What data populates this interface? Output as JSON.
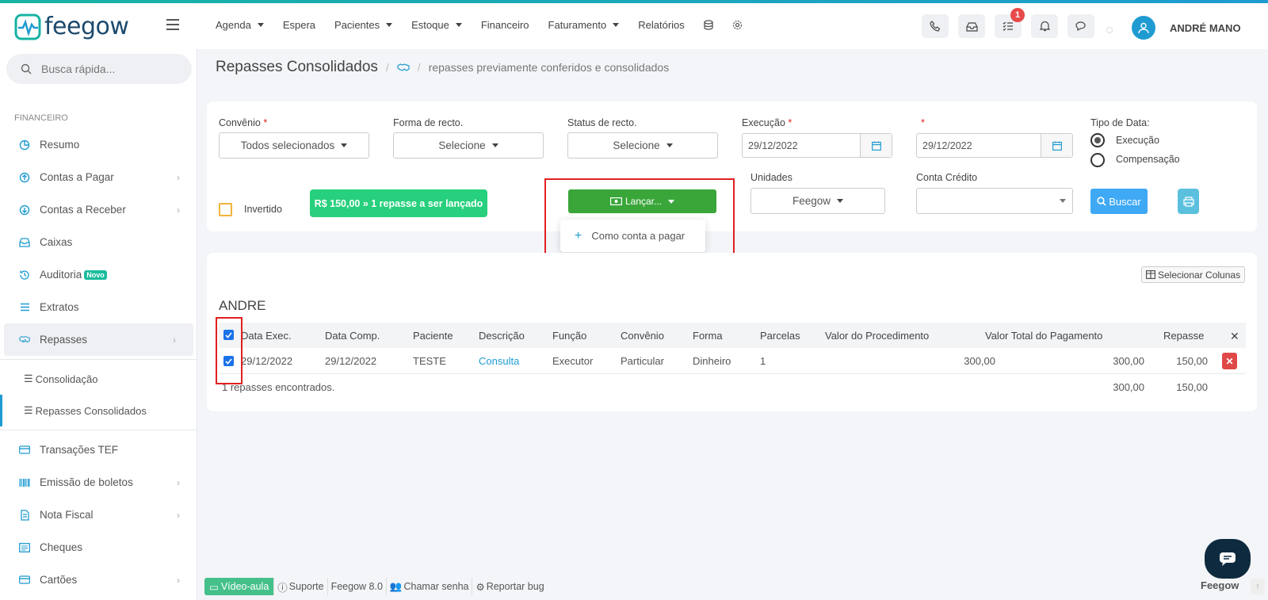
{
  "app": {
    "brand": "feegow",
    "user_name": "ANDRÉ MANO",
    "notification_count": "1"
  },
  "topnav": [
    {
      "label": "Agenda",
      "dropdown": true
    },
    {
      "label": "Espera",
      "dropdown": false
    },
    {
      "label": "Pacientes",
      "dropdown": true
    },
    {
      "label": "Estoque",
      "dropdown": true
    },
    {
      "label": "Financeiro",
      "dropdown": false
    },
    {
      "label": "Faturamento",
      "dropdown": true
    },
    {
      "label": "Relatórios",
      "dropdown": false
    }
  ],
  "sidebar": {
    "search_placeholder": "Busca rápida...",
    "section": "FINANCEIRO",
    "items": [
      {
        "label": "Resumo",
        "icon": "chart-pie-icon"
      },
      {
        "label": "Contas a Pagar",
        "icon": "arrow-up-circle-icon",
        "chevron": true
      },
      {
        "label": "Contas a Receber",
        "icon": "arrow-down-circle-icon",
        "chevron": true
      },
      {
        "label": "Caixas",
        "icon": "inbox-icon"
      },
      {
        "label": "Auditoria",
        "icon": "history-icon",
        "badge": "Novo"
      },
      {
        "label": "Extratos",
        "icon": "list-icon"
      },
      {
        "label": "Repasses",
        "icon": "handshake-icon",
        "chevron": true
      }
    ],
    "sub_items": [
      {
        "label": "Consolidação"
      },
      {
        "label": "Repasses Consolidados"
      }
    ],
    "items_after": [
      {
        "label": "Transações TEF",
        "icon": "credit-card-icon"
      },
      {
        "label": "Emissão de boletos",
        "icon": "barcode-icon",
        "chevron": true
      },
      {
        "label": "Nota Fiscal",
        "icon": "file-icon",
        "chevron": true
      },
      {
        "label": "Cheques",
        "icon": "cheque-icon"
      },
      {
        "label": "Cartões",
        "icon": "card-icon",
        "chevron": true
      }
    ]
  },
  "page": {
    "title": "Repasses Consolidados",
    "crumb": "repasses previamente conferidos e consolidados"
  },
  "filters": {
    "convenio_label": "Convênio",
    "convenio_value": "Todos selecionados",
    "forma_label": "Forma de recto.",
    "forma_value": "Selecione",
    "status_label": "Status de recto.",
    "status_value": "Selecione",
    "execucao_label": "Execução",
    "execucao_from": "29/12/2022",
    "execucao_to": "29/12/2022",
    "tipo_label": "Tipo de Data:",
    "tipo_opt1": "Execução",
    "tipo_opt2": "Compensação",
    "unidades_label": "Unidades",
    "unidades_value": "Feegow",
    "conta_label": "Conta Crédito",
    "conta_value": "",
    "invertido_label": "Invertido",
    "summary_pill": "R$ 150,00 » 1 repasse a ser lançado",
    "lancar_label": "Lançar...",
    "dropdown_item": "Como conta a pagar",
    "buscar_label": "Buscar"
  },
  "table": {
    "select_columns_label": "Selecionar Colunas",
    "group_name": "ANDRE",
    "headers": [
      "Data Exec.",
      "Data Comp.",
      "Paciente",
      "Descrição",
      "Função",
      "Convênio",
      "Forma",
      "Parcelas",
      "Valor do Procedimento",
      "Valor Total do Pagamento",
      "Repasse"
    ],
    "row": {
      "data_exec": "29/12/2022",
      "data_comp": "29/12/2022",
      "paciente": "TESTE",
      "descricao": "Consulta",
      "funcao": "Executor",
      "convenio": "Particular",
      "forma": "Dinheiro",
      "parcelas": "1",
      "valor_proc": "300,00",
      "valor_total": "300,00",
      "repasse": "150,00"
    },
    "footer": {
      "count_text": "1 repasses encontrados.",
      "total": "300,00",
      "repasse_total": "150,00"
    }
  },
  "bottombar": {
    "video": "Vídeo-aula",
    "suporte": "Suporte",
    "version": "Feegow 8.0",
    "chamar": "Chamar senha",
    "bug": "Reportar bug",
    "brand": "Feegow"
  },
  "colors": {
    "accent": "#1f9bd1",
    "green": "#27d07c",
    "lancar": "#3aa63a",
    "danger": "#e04848",
    "highlight": "#e02020"
  }
}
